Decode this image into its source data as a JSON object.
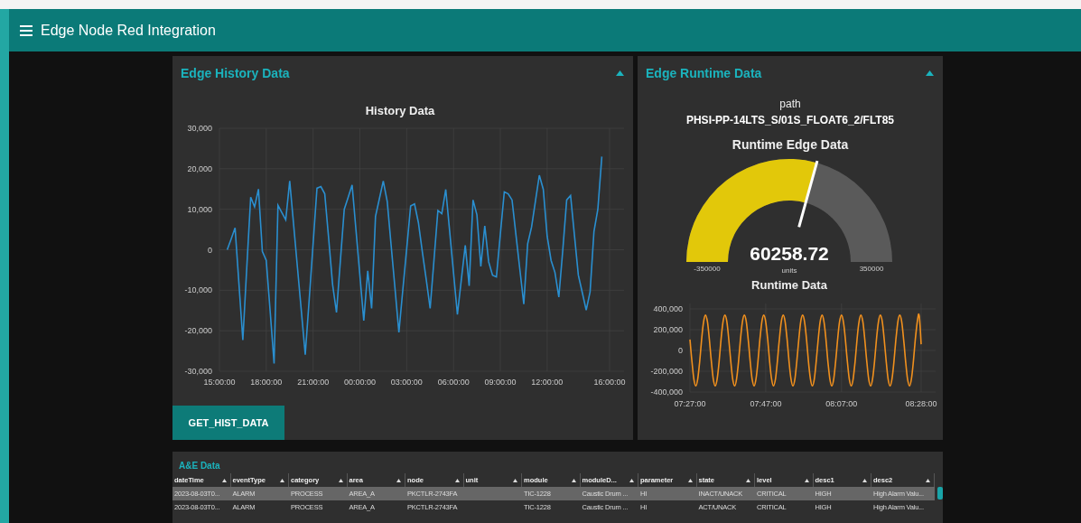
{
  "header": {
    "title": "Edge Node Red Integration"
  },
  "history_card": {
    "title": "Edge History Data",
    "expanded": true,
    "chart_data": {
      "type": "line",
      "title": "History Data",
      "categories": [
        "15:00:00",
        null,
        null,
        null,
        null,
        null,
        null,
        null,
        null,
        null,
        null,
        null,
        "18:00:00",
        null,
        null,
        null,
        null,
        null,
        null,
        null,
        null,
        null,
        null,
        null,
        "21:00:00",
        null,
        null,
        null,
        null,
        null,
        null,
        null,
        null,
        null,
        null,
        null,
        "00:00:00",
        null,
        null,
        null,
        null,
        null,
        null,
        null,
        null,
        null,
        null,
        null,
        "03:00:00",
        null,
        null,
        null,
        null,
        null,
        null,
        null,
        null,
        null,
        null,
        null,
        "06:00:00",
        null,
        null,
        null,
        null,
        null,
        null,
        null,
        null,
        null,
        null,
        null,
        "09:00:00",
        null,
        null,
        null,
        null,
        null,
        null,
        null,
        null,
        null,
        null,
        null,
        "12:00:00",
        null,
        null,
        null,
        null,
        null,
        null,
        null,
        null,
        null,
        null,
        null,
        null,
        null,
        null,
        null,
        "16:00:00"
      ],
      "series": [
        {
          "color": "#2a8fd0",
          "values": [
            null,
            null,
            0,
            2700,
            5400,
            -8450,
            -22300,
            -4650,
            13000,
            10600,
            15000,
            -400,
            -2600,
            -15350,
            -28100,
            11000,
            9200,
            7400,
            17000,
            6275,
            -4450,
            -15175,
            -25900,
            -12200,
            1500,
            15200,
            15600,
            13800,
            2600,
            -8600,
            -15500,
            -2750,
            10000,
            13000,
            16000,
            4800,
            -6300,
            -17500,
            -5200,
            -14500,
            8200,
            12600,
            17000,
            11900,
            1100,
            -9600,
            -20400,
            -10000,
            400,
            10800,
            11300,
            6700,
            -400,
            -7400,
            -14500,
            -2400,
            9700,
            8900,
            14900,
            4600,
            -5700,
            -16000,
            -7450,
            1100,
            -8900,
            12300,
            8600,
            -4100,
            5900,
            -3000,
            -6300,
            -6700,
            3800,
            14300,
            13800,
            12300,
            3700,
            -4800,
            -13400,
            1500,
            5600,
            12000,
            18400,
            14900,
            3300,
            -2600,
            -5600,
            -11700,
            0,
            12300,
            13400,
            3550,
            -6300,
            -10600,
            -14900,
            -10400,
            4500,
            10000,
            23000,
            null,
            null
          ]
        }
      ],
      "ylim": [
        -30000,
        30000
      ],
      "grid": true,
      "yticks": [
        {
          "value": 30000,
          "label": "30,000"
        },
        {
          "value": 20000,
          "label": "20,000"
        },
        {
          "value": 10000,
          "label": "10,000"
        },
        {
          "value": 0,
          "label": "0"
        },
        {
          "value": -10000,
          "label": "-10,000"
        },
        {
          "value": -20000,
          "label": "-20,000"
        },
        {
          "value": -30000,
          "label": "-30,000"
        }
      ]
    },
    "button": "GET_HIST_DATA"
  },
  "runtime_card": {
    "title": "Edge Runtime Data",
    "expanded": true,
    "path_label": "path",
    "path": "PHSI-PP-14LTS_S/01S_FLOAT6_2/FLT85",
    "gauge": {
      "title": "Runtime Edge Data",
      "value": "60258.72",
      "units": "units",
      "min": "-350000",
      "max": "350000",
      "level": 0.586
    },
    "chart_data": {
      "type": "line",
      "title": "Runtime Data",
      "categories": [
        "07:27:00",
        null,
        null,
        null,
        null,
        null,
        null,
        null,
        null,
        null,
        null,
        null,
        null,
        null,
        null,
        null,
        null,
        null,
        null,
        null,
        null,
        null,
        null,
        null,
        null,
        null,
        null,
        null,
        null,
        null,
        null,
        null,
        null,
        null,
        null,
        null,
        null,
        null,
        null,
        "07:47:00",
        null,
        null,
        null,
        null,
        null,
        null,
        null,
        null,
        null,
        null,
        null,
        null,
        null,
        null,
        null,
        null,
        null,
        null,
        null,
        null,
        null,
        null,
        null,
        null,
        null,
        null,
        null,
        null,
        null,
        null,
        null,
        null,
        null,
        null,
        null,
        null,
        null,
        null,
        "08:07:00",
        null,
        null,
        null,
        null,
        null,
        null,
        null,
        null,
        null,
        null,
        null,
        null,
        null,
        null,
        null,
        null,
        null,
        null,
        null,
        null,
        null,
        null,
        null,
        null,
        null,
        null,
        null,
        null,
        null,
        null,
        null,
        null,
        null,
        null,
        null,
        null,
        null,
        null,
        null,
        null,
        "08:28:00"
      ],
      "series": [
        {
          "color": "#f0901e",
          "values": [
            105000,
            -105000,
            -275000,
            -340000,
            -275000,
            -105000,
            105000,
            275000,
            340000,
            275000,
            105000,
            -105000,
            -275000,
            -340000,
            -275000,
            -105000,
            105000,
            275000,
            340000,
            275000,
            105000,
            -105000,
            -275000,
            -340000,
            -275000,
            -105000,
            105000,
            275000,
            340000,
            275000,
            105000,
            -105000,
            -275000,
            -340000,
            -275000,
            -105000,
            105000,
            275000,
            340000,
            275000,
            105000,
            -105000,
            -275000,
            -340000,
            -275000,
            -105000,
            105000,
            275000,
            340000,
            275000,
            105000,
            -105000,
            -275000,
            -340000,
            -275000,
            -105000,
            105000,
            275000,
            340000,
            275000,
            105000,
            -105000,
            -275000,
            -340000,
            -275000,
            -105000,
            105000,
            275000,
            340000,
            275000,
            105000,
            -105000,
            -275000,
            -340000,
            -275000,
            -105000,
            105000,
            275000,
            340000,
            275000,
            105000,
            -105000,
            -275000,
            -340000,
            -275000,
            -105000,
            105000,
            275000,
            340000,
            275000,
            105000,
            -105000,
            -275000,
            -340000,
            -275000,
            -105000,
            105000,
            275000,
            340000,
            275000,
            105000,
            -105000,
            -275000,
            -340000,
            -275000,
            -105000,
            105000,
            275000,
            340000,
            275000,
            105000,
            -105000,
            -275000,
            -340000,
            -275000,
            -105000,
            105000,
            275000,
            340000,
            60000
          ]
        }
      ],
      "ylim": [
        -400000,
        400000
      ],
      "grid": true,
      "yticks": [
        {
          "value": 400000,
          "label": "400,000"
        },
        {
          "value": 200000,
          "label": "200,000"
        },
        {
          "value": 0,
          "label": "0"
        },
        {
          "value": -200000,
          "label": "-200,000"
        },
        {
          "value": -400000,
          "label": "-400,000"
        }
      ]
    }
  },
  "table": {
    "title": "A&E Data",
    "columns": [
      "dateTime",
      "eventType",
      "category",
      "area",
      "node",
      "unit",
      "module",
      "moduleD...",
      "parameter",
      "state",
      "level",
      "desc1",
      "desc2"
    ],
    "rows": [
      {
        "selected": true,
        "cells": [
          "2023-08-03T0...",
          "ALARM",
          "PROCESS",
          "AREA_A",
          "PKCTLR-2743FA",
          null,
          "TIC-1228",
          "Caustic Drum ...",
          "HI",
          "INACT/UNACK",
          "CRITICAL",
          "HIGH",
          "High Alarm Valu..."
        ]
      },
      {
        "selected": false,
        "cells": [
          "2023-08-03T0...",
          "ALARM",
          "PROCESS",
          "AREA_A",
          "PKCTLR-2743FA",
          null,
          "TIC-1228",
          "Caustic Drum ...",
          "HI",
          "ACT/UNACK",
          "CRITICAL",
          "HIGH",
          "High Alarm Valu..."
        ]
      }
    ]
  }
}
